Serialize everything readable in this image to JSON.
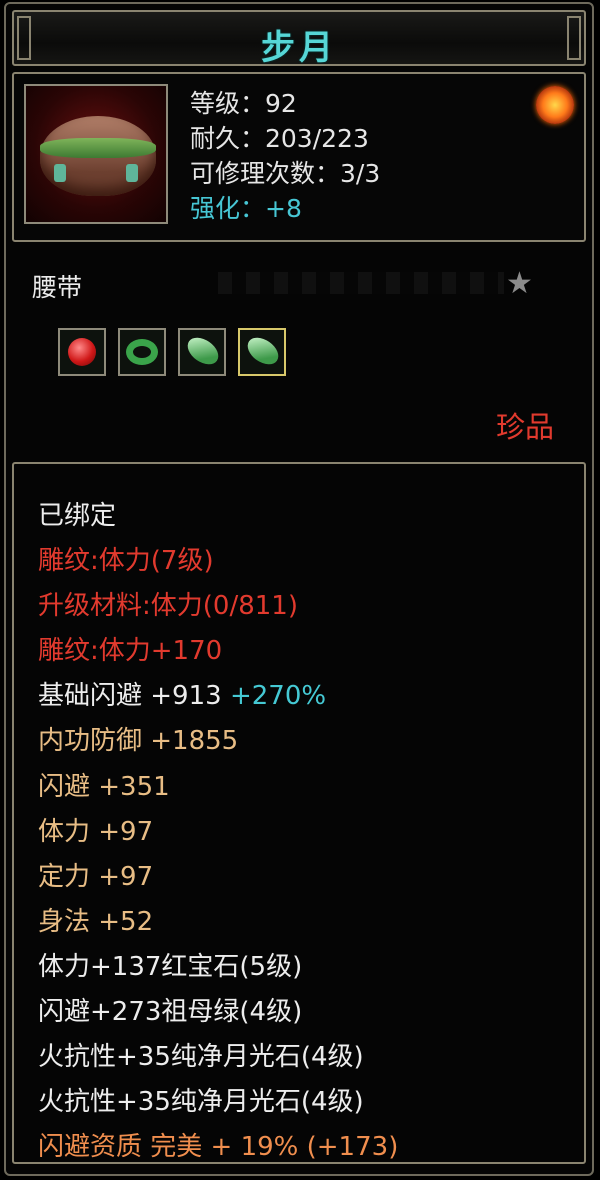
{
  "item": {
    "name": "步月",
    "type": "腰带",
    "rarity": "珍品",
    "stats": {
      "level": "等级：92",
      "durability": "耐久：203/223",
      "repair": "可修理次数：3/3",
      "enhance": "强化：+8"
    }
  },
  "gems": [
    {
      "name": "ruby-gem"
    },
    {
      "name": "emerald-gem"
    },
    {
      "name": "moonstone-gem"
    },
    {
      "name": "moonstone-gem"
    }
  ],
  "attributes": {
    "bound": "已绑定",
    "engrave": "雕纹:体力(7级)",
    "upgrade_material": "升级材料:体力(0/811)",
    "engrave_bonus": "雕纹:体力+170",
    "base_dodge": "基础闪避 +913",
    "base_dodge_pct": "+270%",
    "inner_defense": "内功防御 +1855",
    "dodge": "闪避 +351",
    "stamina": "体力 +97",
    "focus": "定力 +97",
    "agility": "身法 +52",
    "gem1": "体力+137红宝石(5级)",
    "gem2": "闪避+273祖母绿(4级)",
    "gem3": "火抗性+35纯净月光石(4级)",
    "gem4": "火抗性+35纯净月光石(4级)",
    "quality": "闪避资质 完美 + 19% (+173)"
  },
  "colors": {
    "title": "#56d6d6",
    "engrave": "#e23a2e",
    "stat": "#e8bd85",
    "percent": "#45c9d4",
    "quality": "#f08e4e",
    "rarity": "#e13a2e"
  }
}
